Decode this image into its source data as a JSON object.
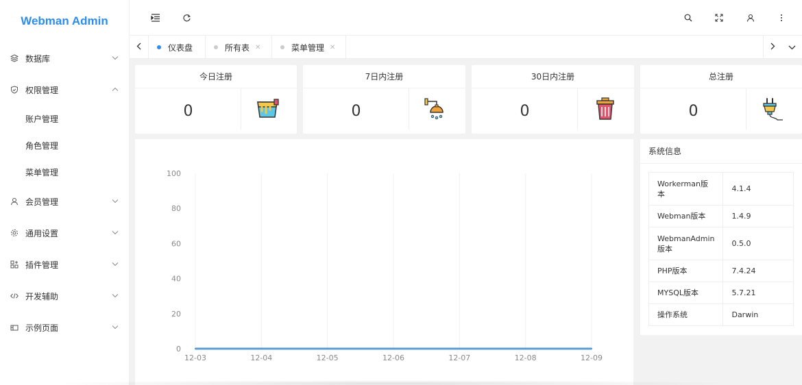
{
  "app": {
    "title": "Webman Admin"
  },
  "sidebar": {
    "items": [
      {
        "label": "数据库",
        "icon": "layers-icon",
        "expanded": false
      },
      {
        "label": "权限管理",
        "icon": "shield-check-icon",
        "expanded": true,
        "children": [
          {
            "label": "账户管理"
          },
          {
            "label": "角色管理"
          },
          {
            "label": "菜单管理"
          }
        ]
      },
      {
        "label": "会员管理",
        "icon": "user-icon",
        "expanded": false
      },
      {
        "label": "通用设置",
        "icon": "gear-icon",
        "expanded": false
      },
      {
        "label": "插件管理",
        "icon": "apps-icon",
        "expanded": false
      },
      {
        "label": "开发辅助",
        "icon": "code-icon",
        "expanded": false
      },
      {
        "label": "示例页面",
        "icon": "template-icon",
        "expanded": false
      }
    ]
  },
  "header": {
    "icons": [
      "menu-fold-icon",
      "refresh-icon",
      "search-icon",
      "fullscreen-icon",
      "user-icon",
      "more-vertical-icon"
    ]
  },
  "tabs": [
    {
      "label": "仪表盘",
      "active": true,
      "closable": false
    },
    {
      "label": "所有表",
      "active": false,
      "closable": true
    },
    {
      "label": "菜单管理",
      "active": false,
      "closable": true
    }
  ],
  "cards": [
    {
      "title": "今日注册",
      "value": "0",
      "icon": "paint-bucket-icon"
    },
    {
      "title": "7日内注册",
      "value": "0",
      "icon": "shower-icon"
    },
    {
      "title": "30日内注册",
      "value": "0",
      "icon": "trash-can-icon"
    },
    {
      "title": "总注册",
      "value": "0",
      "icon": "plug-icon"
    }
  ],
  "chart_data": {
    "type": "line",
    "categories": [
      "12-03",
      "12-04",
      "12-05",
      "12-06",
      "12-07",
      "12-08",
      "12-09"
    ],
    "values": [
      0,
      0,
      0,
      0,
      0,
      0,
      0
    ],
    "yticks": [
      "0",
      "20",
      "40",
      "60",
      "80",
      "100"
    ],
    "ylim": [
      0,
      100
    ],
    "grid": "vertical",
    "color": "#5b9bd5"
  },
  "sysinfo": {
    "title": "系统信息",
    "rows": [
      {
        "key": "Workerman版本",
        "value": "4.1.4"
      },
      {
        "key": "Webman版本",
        "value": "1.4.9"
      },
      {
        "key": "WebmanAdmin版本",
        "value": "0.5.0"
      },
      {
        "key": "PHP版本",
        "value": "7.4.24"
      },
      {
        "key": "MYSQL版本",
        "value": "5.7.21"
      },
      {
        "key": "操作系统",
        "value": "Darwin"
      }
    ]
  },
  "colors": {
    "accent": "#2d8cf0",
    "line": "#5b9bd5"
  }
}
